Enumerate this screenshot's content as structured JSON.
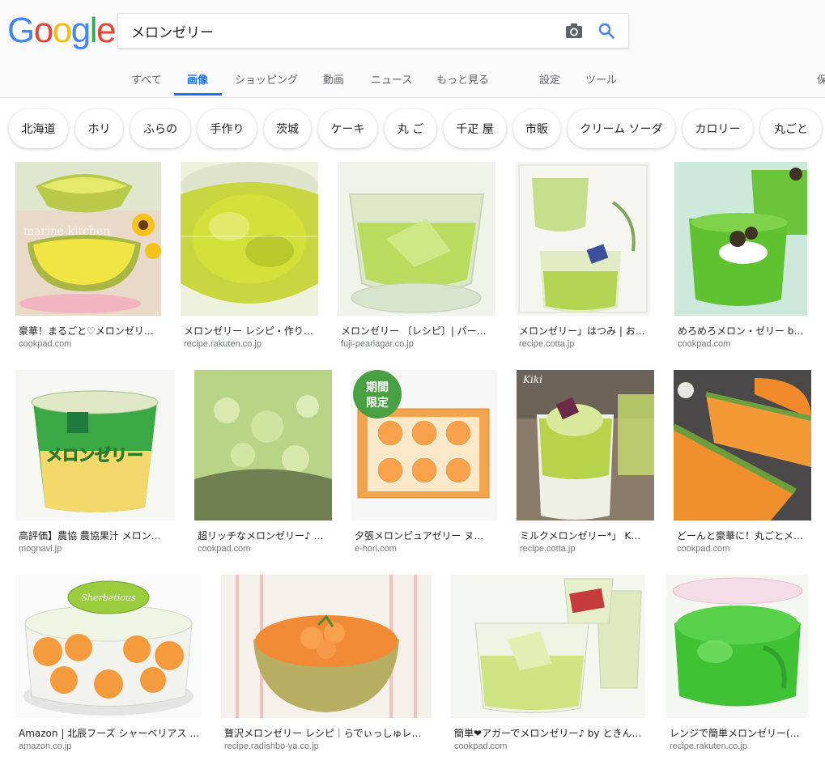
{
  "logo": {
    "letters": [
      "G",
      "o",
      "o",
      "g",
      "l",
      "e"
    ],
    "colors": [
      "#4285F4",
      "#EA4335",
      "#FBBC05",
      "#4285F4",
      "#34A853",
      "#EA4335"
    ]
  },
  "search": {
    "value": "メロンゼリー"
  },
  "nav": {
    "items": [
      "すべて",
      "画像",
      "ショッピング",
      "動画",
      "ニュース",
      "もっと見る",
      "設定",
      "ツール",
      "保"
    ],
    "active_index": 1
  },
  "chips": [
    "北海道",
    "ホリ",
    "ふらの",
    "手作り",
    "茨城",
    "ケーキ",
    "丸 ご",
    "千疋 屋",
    "市販",
    "クリーム ソーダ",
    "カロリー",
    "丸ごと"
  ],
  "results": [
    {
      "title": "豪華！まるごと♡メロンゼリ…",
      "domain": "cookpad.com",
      "watermark": "marine kitchen"
    },
    {
      "title": "メロンゼリー レシピ・作り…",
      "domain": "recipe.rakuten.co.jp"
    },
    {
      "title": "メロンゼリー 〔レシピ〕| パー…",
      "domain": "fuji-pearlagar.co.jp"
    },
    {
      "title": "メロンゼリー」はつみ | お…",
      "domain": "recipe.cotta.jp"
    },
    {
      "title": "めろめろメロン・ゼリー b…",
      "domain": "cookpad.com"
    },
    {
      "title": "高評価】農協 農協果汁 メロン…",
      "domain": "mognavi.jp",
      "product_text": "メロンゼリー"
    },
    {
      "title": "超リッチなメロンゼリー♪ …",
      "domain": "cookpad.com"
    },
    {
      "title": "夕張メロンピュアゼリー ヌ…",
      "domain": "e-hori.com",
      "badge_lines": [
        "期間",
        "限定"
      ]
    },
    {
      "title": "ミルクメロンゼリー*」 K…",
      "domain": "recipe.cotta.jp",
      "watermark": "Kiki"
    },
    {
      "title": "どーんと豪華に！丸ごとメ…",
      "domain": "cookpad.com"
    },
    {
      "title": "Amazon | 北辰フーズ シャーベリアス …",
      "domain": "amazon.co.jp",
      "product_text": "Sherbetious"
    },
    {
      "title": "贅沢メロンゼリー レシピ｜らでぃっしゅレ…",
      "domain": "recipe.radishbo-ya.co.jp"
    },
    {
      "title": "簡単❤アガーでメロンゼリー♪ by ときん…",
      "domain": "cookpad.com"
    },
    {
      "title": "レンジで簡単メロンゼリー(…",
      "domain": "recipe.rakuten.co.jp"
    }
  ],
  "colors": {
    "accent": "#1a73e8",
    "nav_text": "#5f6368",
    "domain_text": "#70757a",
    "jelly_green": "#9bd83a",
    "melon_orange": "#f29a3c"
  }
}
